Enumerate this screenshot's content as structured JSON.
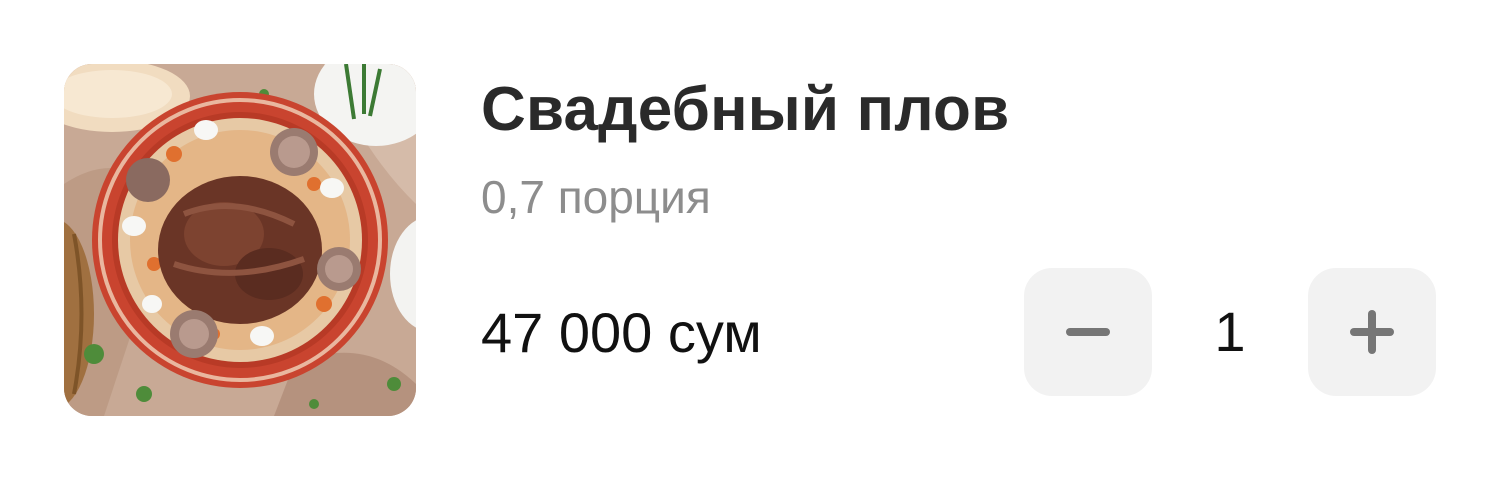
{
  "product": {
    "name": "Свадебный плов",
    "portion": "0,7 порция",
    "price": "47 000 сум",
    "image_alt": "plov-dish-photo"
  },
  "stepper": {
    "quantity": "1",
    "decrement_icon": "minus-icon",
    "increment_icon": "plus-icon"
  },
  "colors": {
    "title": "#2a2a2a",
    "subtitle": "#8d8d8d",
    "button_bg": "#f2f2f2",
    "button_icon": "#767676"
  }
}
